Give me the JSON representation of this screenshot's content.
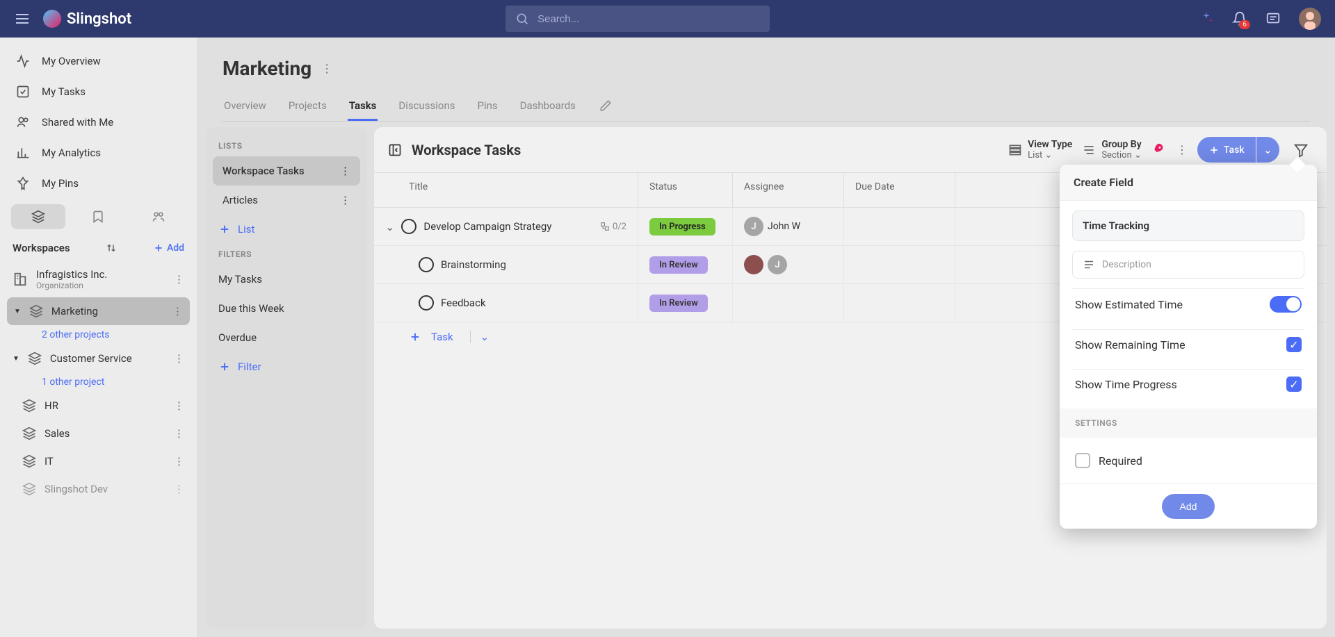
{
  "app": {
    "name": "Slingshot"
  },
  "search": {
    "placeholder": "Search..."
  },
  "notifications": {
    "count": "6"
  },
  "nav": {
    "overview": "My Overview",
    "tasks": "My Tasks",
    "shared": "Shared with Me",
    "analytics": "My Analytics",
    "pins": "My Pins"
  },
  "workspaces": {
    "label": "Workspaces",
    "add": "Add",
    "org": {
      "name": "Infragistics Inc.",
      "sub": "Organization"
    },
    "items": [
      {
        "name": "Marketing",
        "other": "2 other projects"
      },
      {
        "name": "Customer Service",
        "other": "1 other project"
      },
      {
        "name": "HR"
      },
      {
        "name": "Sales"
      },
      {
        "name": "IT"
      },
      {
        "name": "Slingshot Dev"
      }
    ]
  },
  "page": {
    "title": "Marketing",
    "tabs": [
      "Overview",
      "Projects",
      "Tasks",
      "Discussions",
      "Pins",
      "Dashboards"
    ]
  },
  "lists": {
    "label": "LISTS",
    "items": [
      "Workspace Tasks",
      "Articles"
    ],
    "add": "List",
    "filtersLabel": "FILTERS",
    "filters": [
      "My Tasks",
      "Due this Week",
      "Overdue"
    ],
    "addFilter": "Filter"
  },
  "tasksPanel": {
    "title": "Workspace Tasks",
    "viewType": {
      "label": "View Type",
      "value": "List"
    },
    "groupBy": {
      "label": "Group By",
      "value": "Section"
    },
    "newTask": "Task",
    "columns": {
      "title": "Title",
      "status": "Status",
      "assignee": "Assignee",
      "due": "Due Date"
    },
    "rows": [
      {
        "name": "Develop Campaign Strategy",
        "subtasks": "0/2",
        "status": "In Progress",
        "statusClass": "inprogress",
        "assignee": "John W",
        "av": "J"
      },
      {
        "name": "Brainstorming",
        "status": "In Review",
        "statusClass": "inreview",
        "sub": true,
        "twoAv": true
      },
      {
        "name": "Feedback",
        "status": "In Review",
        "statusClass": "inreview",
        "sub": true
      }
    ],
    "addTask": "Task"
  },
  "createField": {
    "title": "Create Field",
    "name": "Time Tracking",
    "descPlaceholder": "Description",
    "opts": {
      "estimated": "Show Estimated Time",
      "remaining": "Show Remaining Time",
      "progress": "Show Time Progress"
    },
    "settingsLabel": "SETTINGS",
    "required": "Required",
    "addBtn": "Add"
  }
}
